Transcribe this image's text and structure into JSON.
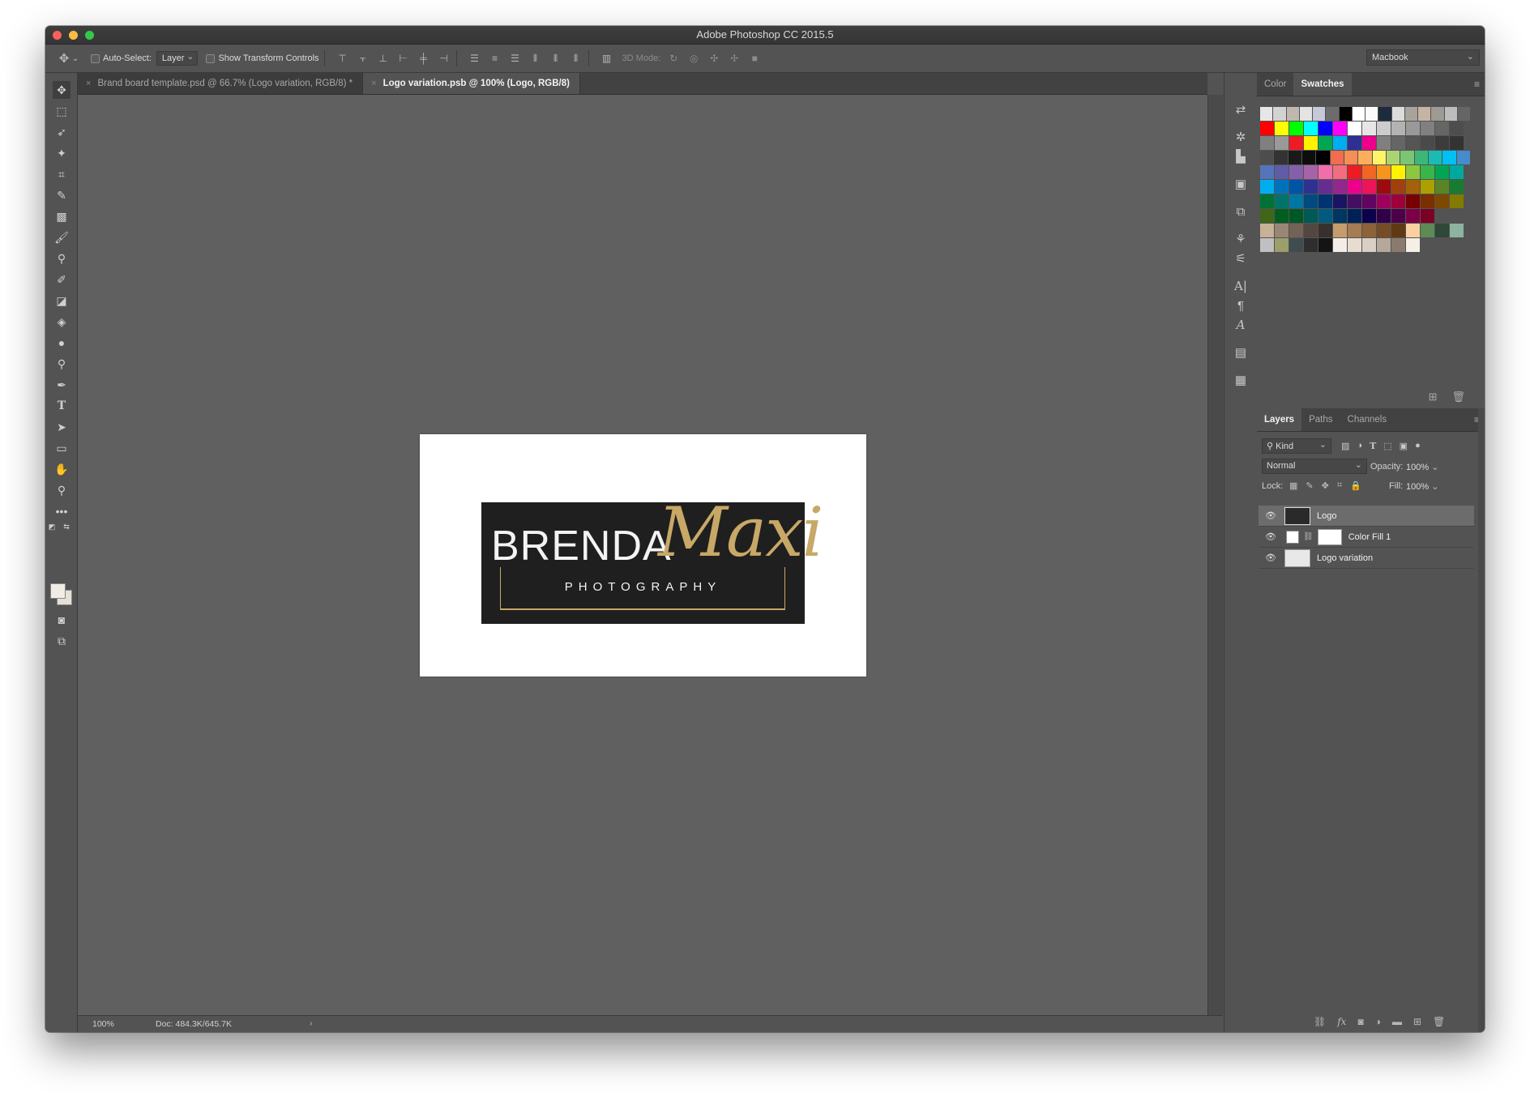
{
  "window": {
    "title": "Adobe Photoshop CC 2015.5"
  },
  "options_bar": {
    "auto_select_label": "Auto-Select:",
    "auto_select_value": "Layer",
    "show_transform_label": "Show Transform Controls",
    "mode_3d_label": "3D Mode:",
    "workspace": "Macbook"
  },
  "document_tabs": [
    {
      "label": "Brand board template.psd @ 66.7% (Logo variation, RGB/8) *",
      "active": false
    },
    {
      "label": "Logo variation.psb @ 100% (Logo, RGB/8)",
      "active": true
    }
  ],
  "canvas": {
    "logo_name": "BRENDA",
    "logo_script": "Maxi",
    "logo_sub": "PHOTOGRAPHY",
    "colors": {
      "logo_bg": "#1f1f1f",
      "gold": "#c8a867",
      "paper": "#ffffff"
    }
  },
  "status_bar": {
    "zoom": "100%",
    "doc_size": "Doc: 484.3K/645.7K"
  },
  "swatches_panel": {
    "tabs": [
      {
        "label": "Color",
        "active": false
      },
      {
        "label": "Swatches",
        "active": true
      }
    ],
    "rows": [
      [
        "#e6e6e6",
        "#d3d3d3",
        "#c0b8ae",
        "#e4e4e4",
        "#c6c9d8",
        "#6c6c6c",
        "#000000",
        "#ffffff",
        "#fafafa",
        "#1e2b3c",
        "#dcdcdc",
        "#a8a39b",
        "#c5b4a3",
        "#9e9a94",
        "#bdbdbd",
        "#656565"
      ],
      [
        "#ff0000",
        "#ffff00",
        "#00ff00",
        "#00ffff",
        "#0000ff",
        "#ff00ff",
        "#ffffff",
        "#e6e6e6",
        "#cccccc",
        "#b3b3b3",
        "#999999",
        "#808080",
        "#666666",
        "#4d4d4d"
      ],
      [
        "#808080",
        "#999999",
        "#ed1c24",
        "#fff200",
        "#00a651",
        "#00aeef",
        "#2e3192",
        "#ec008c",
        "#7f7f7f",
        "#666666",
        "#555555",
        "#4a4a4a",
        "#3c3c3c",
        "#333333"
      ],
      [
        "#4d4d4d",
        "#333333",
        "#1a1a1a",
        "#0d0d0d",
        "#000000",
        "#f26c4f",
        "#f68e55",
        "#fbaf5c",
        "#fff467",
        "#acd372",
        "#7cc576",
        "#3bb878",
        "#1abbb4",
        "#00bff3",
        "#448ccb"
      ],
      [
        "#5674b9",
        "#605ca8",
        "#8560a8",
        "#a763a8",
        "#f06eaa",
        "#f26d7d",
        "#ed1c24",
        "#f26522",
        "#f7941d",
        "#fff200",
        "#8dc63f",
        "#39b54a",
        "#00a651",
        "#00a99d"
      ],
      [
        "#00aeef",
        "#0072bc",
        "#0054a6",
        "#2e3192",
        "#662d91",
        "#92278f",
        "#ec008c",
        "#ed145b",
        "#9e0b0f",
        "#a0410d",
        "#a36209",
        "#aba000",
        "#598527",
        "#197b30"
      ],
      [
        "#007236",
        "#00746b",
        "#0076a3",
        "#004a80",
        "#003471",
        "#1b1464",
        "#440e62",
        "#630460",
        "#9e005d",
        "#9e0039",
        "#790000",
        "#7b2e00",
        "#7d4900",
        "#827b00"
      ],
      [
        "#406618",
        "#005e20",
        "#005826",
        "#005952",
        "#005b7f",
        "#003663",
        "#002157",
        "#0d004c",
        "#32004b",
        "#4b0049",
        "#7b0046",
        "#7a0026"
      ],
      [
        "#c7b299",
        "#998675",
        "#736357",
        "#534741",
        "#37302d",
        "#c69c6d",
        "#a67c52",
        "#8c6239",
        "#754c24",
        "#603913",
        "#fbd0a0",
        "#5e8a56",
        "#2f4837",
        "#8eb3a0"
      ],
      [
        "#c0c0c0",
        "#9b9f6a",
        "#3f4d51",
        "#2e2e2e",
        "#141414",
        "#f3ede7",
        "#e8dcd0",
        "#d9cfc4",
        "#b5a79a",
        "#8a7a6f",
        "#f5efe6"
      ]
    ]
  },
  "layers_panel": {
    "tabs": [
      {
        "label": "Layers",
        "active": true
      },
      {
        "label": "Paths",
        "active": false
      },
      {
        "label": "Channels",
        "active": false
      }
    ],
    "kind_filter": "Kind",
    "blend_mode": "Normal",
    "opacity_label": "Opacity:",
    "opacity_value": "100%",
    "lock_label": "Lock:",
    "fill_label": "Fill:",
    "fill_value": "100%",
    "layers": [
      {
        "name": "Logo",
        "selected": true
      },
      {
        "name": "Color Fill 1",
        "selected": false
      },
      {
        "name": "Logo variation",
        "selected": false
      }
    ]
  }
}
